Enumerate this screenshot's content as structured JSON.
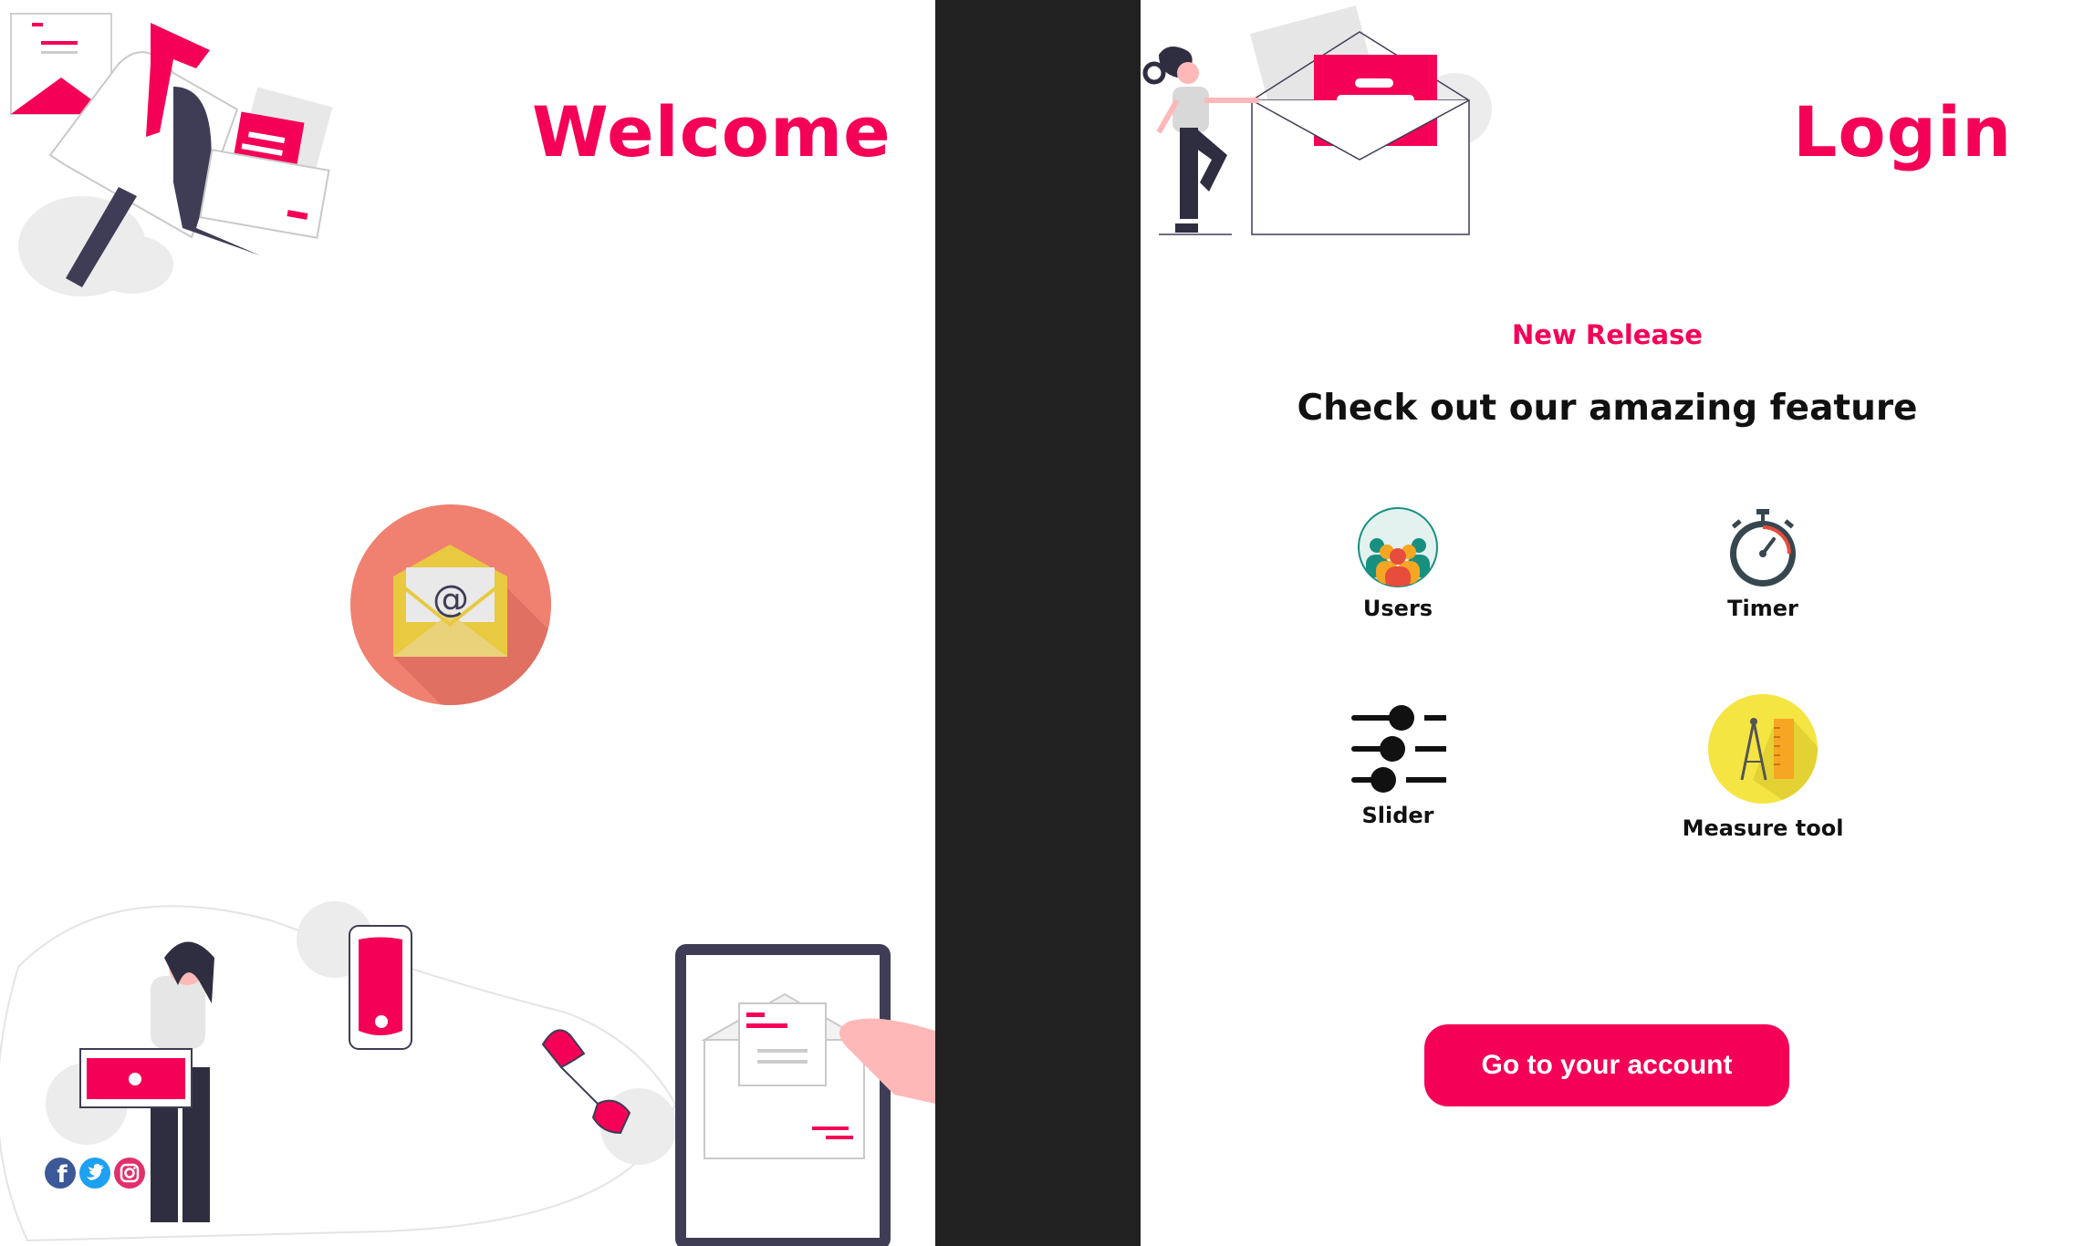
{
  "left_panel": {
    "title": "Welcome",
    "social": [
      {
        "icon": "facebook-icon",
        "color": "#3b5998"
      },
      {
        "icon": "twitter-icon",
        "color": "#1da1f2"
      },
      {
        "icon": "instagram-icon",
        "color": "#e1306c"
      }
    ]
  },
  "right_panel": {
    "title": "Login",
    "badge": "New Release",
    "headline": "Check out our amazing feature",
    "features": [
      {
        "label": "Users",
        "icon": "users-icon"
      },
      {
        "label": "Timer",
        "icon": "timer-icon"
      },
      {
        "label": "Slider",
        "icon": "slider-icon"
      },
      {
        "label": "Measure tool",
        "icon": "measure-tool-icon"
      }
    ],
    "cta": "Go to your account"
  },
  "colors": {
    "accent": "#f50057",
    "divider": "#212121",
    "dark": "#3f3d56"
  }
}
